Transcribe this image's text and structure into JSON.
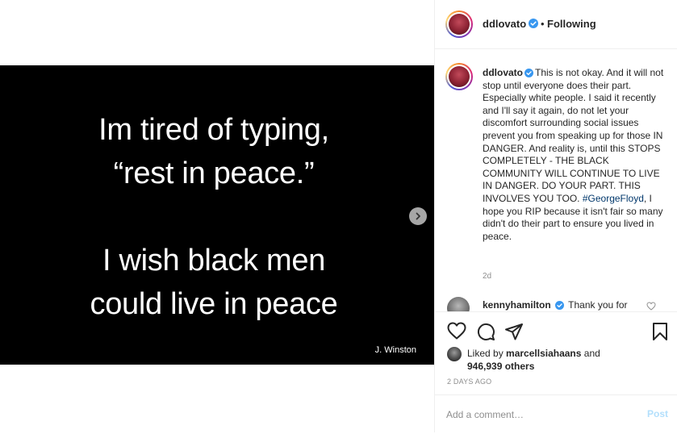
{
  "media": {
    "lines": [
      "Im tired of typing,",
      "“rest in peace.”",
      "I wish black men",
      "could live in peace"
    ],
    "credit": "J. Winston",
    "next_icon": "chevron-right-icon"
  },
  "header": {
    "username": "ddlovato",
    "separator": "•",
    "following_label": "Following",
    "more_icon": "more-options-icon"
  },
  "caption": {
    "username": "ddlovato",
    "text_before_tag": "This is not okay. And it will not stop until everyone does their part. Especially white people. I said it recently and I'll say it again, do not let your discomfort surrounding social issues prevent you from speaking up for those IN DANGER. And reality is, until this STOPS COMPLETELY - THE BLACK COMMUNITY WILL CONTINUE TO LIVE IN DANGER. DO YOUR PART. THIS INVOLVES YOU TOO.",
    "hashtag": "#GeorgeFloyd",
    "text_after_tag": ", I hope you RIP because it isn't fair so many didn't do their part to ensure you lived in peace.",
    "time": "2d"
  },
  "comment": {
    "username": "kennyhamilton",
    "text": "Thank you for"
  },
  "actions": {
    "like_icon": "heart-icon",
    "comment_icon": "comment-icon",
    "share_icon": "share-icon",
    "save_icon": "bookmark-icon"
  },
  "likes": {
    "prefix": "Liked by",
    "user": "marcellsiahaans",
    "middle": "and",
    "count": "946,939 others"
  },
  "timestamp": "2 DAYS AGO",
  "comment_box": {
    "placeholder": "Add a comment…",
    "post_label": "Post"
  },
  "colors": {
    "verified_blue": "#3897f0",
    "hashtag_blue": "#00376b",
    "post_button_disabled": "#b2dffc",
    "muted_text": "#8e8e8e"
  }
}
